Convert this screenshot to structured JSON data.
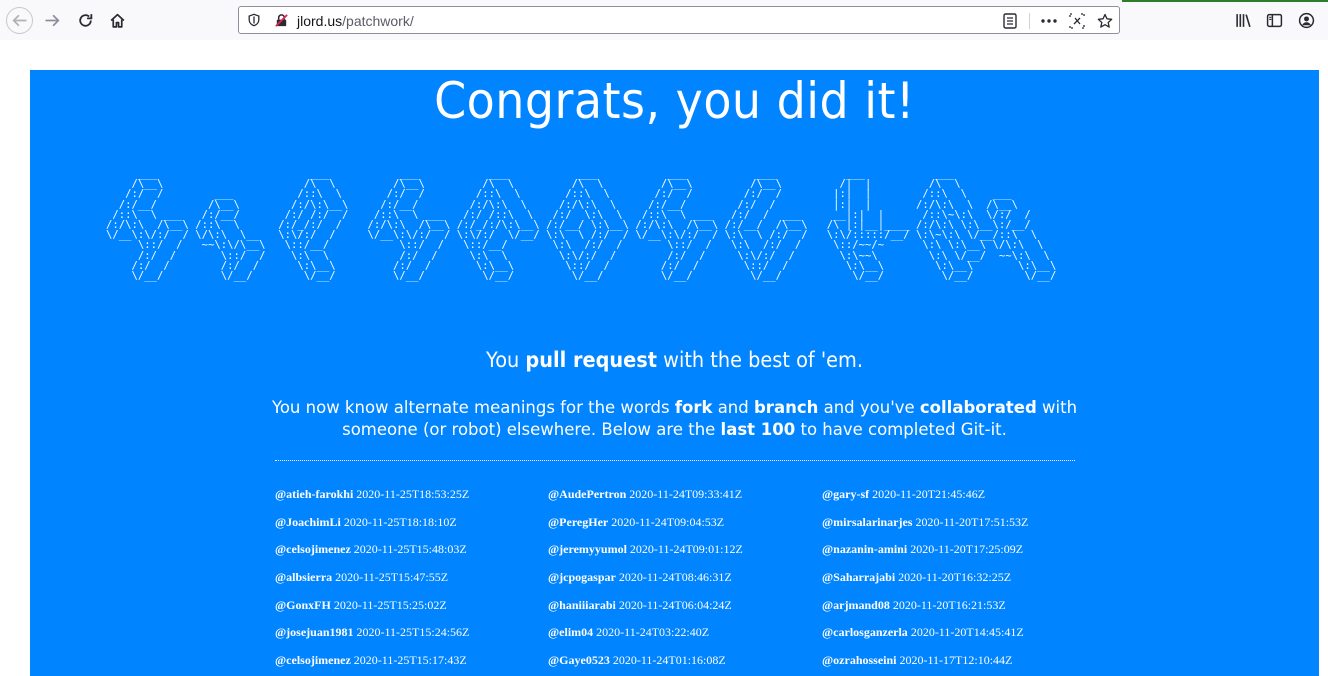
{
  "browser": {
    "url_host": "jlord.us",
    "url_path": "/patchwork/",
    "icons": {
      "back": "arrow-left-icon",
      "forward": "arrow-right-icon",
      "reload": "reload-icon",
      "home": "home-icon",
      "tracking": "shield-icon",
      "insecure": "broken-lock-icon",
      "reader": "reader-view-icon",
      "more": "ellipsis-icon",
      "screenshot": "screenshot-icon",
      "bookmark": "star-icon",
      "library": "library-icon",
      "sidebar": "sidebar-icon",
      "account": "account-icon"
    }
  },
  "page": {
    "background": "#0084ff",
    "headline": "Congrats, you did it!",
    "tagline": {
      "before": "You ",
      "bold": "pull request",
      "after": " with the best of 'em."
    },
    "intro": {
      "p1": "You now know alternate meanings for the words ",
      "fork": "fork",
      "p2": " and ",
      "branch": "branch",
      "p3": " and you've ",
      "collaborated": "collaborated",
      "p4": " with someone (or robot) elsewhere. Below are the ",
      "last100": "last 100",
      "p5": " to have completed Git-it."
    },
    "ascii_art": "     ___                        ___           ___           ___           ___           ___           ___           ___           ___          \n    /\\__\\                      /\\  \\         /\\__\\         /\\  \\         /\\  \\         /\\__\\         /\\__\\         /|  |         /\\  \\         \n   /:/  /        ___          /::\\  \\       /:/  /        /::\\  \\       /::\\  \\       /:/  /        /:/  /        |:|  |        /::\\  \\    ___ \n  /:/__/        /\\__\\        /:/\\:\\__\\     /:/__/        /:/\\:\\  \\     /:/\\:\\  \\     /:/__/        /:/  /         |:|  |       /:/\\:\\  \\  /\\__\\\n /::\\  \\ ___   /:/__/       /:/ /:/  /    /::\\  \\ ___   /:/ /::\\  \\   /:/  \\:\\  \\   /::\\  \\ ___   /:/  /  ___     __|:|  |      /::\\~\\:\\  \\/:/  /\n/:/\\:\\  /\\__\\ /::\\  \\      /:/_/:/  /    /:/\\:\\  /\\__\\ /:/_/:/\\:\\__\\ /:/__/ \\:\\__\\ /:/\\:\\  /\\__\\ /:/__/  /\\__\\   /\\ |:|__|____ /:/\\:\\ \\:\\__\\:/__/ \n\\/__\\:\\/:/  / \\/\\:\\  \\__   \\:\\/:/  /     \\/__\\:\\/:/  / \\:\\/:/  \\/__/ \\:\\  \\ /:/  / \\/__\\:\\/:/  / \\:\\  \\ /:/  /   \\:\\/:::::/__/ \\:\\~\\:\\ \\/__/::\\  \\\n     \\::/  /   ~~\\:\\/\\__\\   \\::/__/           \\::/  /   \\::/__/       \\:\\  /:/  /       \\::/  /   \\:\\  /:/  /     \\::/~~/~      \\:\\ \\:\\__\\ \\/\\:\\  \\\n     /:/  /       \\::/  /    \\:\\  \\           /:/  /     \\:\\  \\        \\:\\/:/  /        /:/  /     \\:\\/:/  /       \\:\\~~\\        \\:\\ \\/__/  ~~\\:\\  \\\n    /:/  /        /:/  /      \\:\\__\\         /:/  /       \\:\\__\\        \\::/  /        /:/  /       \\::/  /         \\:\\__\\        \\:\\__\\       \\:\\__\\\n    \\/__/         \\/__/        \\/__/         \\/__/         \\/__/         \\/__/         \\/__/         \\/__/           \\/__/         \\/__/        \\/__/",
    "completions": [
      [
        {
          "user": "@atieh-farokhi",
          "time": "2020-11-25T18:53:25Z"
        },
        {
          "user": "@JoachimLi",
          "time": "2020-11-25T18:18:10Z"
        },
        {
          "user": "@celsojimenez",
          "time": "2020-11-25T15:48:03Z"
        },
        {
          "user": "@albsierra",
          "time": "2020-11-25T15:47:55Z"
        },
        {
          "user": "@GonxFH",
          "time": "2020-11-25T15:25:02Z"
        },
        {
          "user": "@josejuan1981",
          "time": "2020-11-25T15:24:56Z"
        },
        {
          "user": "@celsojimenez",
          "time": "2020-11-25T15:17:43Z"
        }
      ],
      [
        {
          "user": "@AudePertron",
          "time": "2020-11-24T09:33:41Z"
        },
        {
          "user": "@PeregHer",
          "time": "2020-11-24T09:04:53Z"
        },
        {
          "user": "@jeremyyumol",
          "time": "2020-11-24T09:01:12Z"
        },
        {
          "user": "@jcpogaspar",
          "time": "2020-11-24T08:46:31Z"
        },
        {
          "user": "@haniiiarabi",
          "time": "2020-11-24T06:04:24Z"
        },
        {
          "user": "@elim04",
          "time": "2020-11-24T03:22:40Z"
        },
        {
          "user": "@Gaye0523",
          "time": "2020-11-24T01:16:08Z"
        }
      ],
      [
        {
          "user": "@gary-sf",
          "time": "2020-11-20T21:45:46Z"
        },
        {
          "user": "@mirsalarinarjes",
          "time": "2020-11-20T17:51:53Z"
        },
        {
          "user": "@nazanin-amini",
          "time": "2020-11-20T17:25:09Z"
        },
        {
          "user": "@Saharrajabi",
          "time": "2020-11-20T16:32:25Z"
        },
        {
          "user": "@arjmand08",
          "time": "2020-11-20T16:21:53Z"
        },
        {
          "user": "@carlosganzerla",
          "time": "2020-11-20T14:45:41Z"
        },
        {
          "user": "@ozrahosseini",
          "time": "2020-11-17T12:10:44Z"
        }
      ]
    ]
  }
}
